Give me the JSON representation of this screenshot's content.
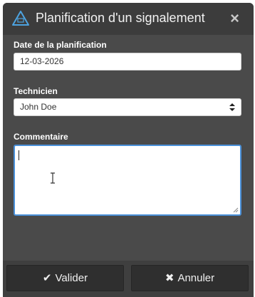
{
  "dialog": {
    "title": "Planification d'un signalement",
    "close_glyph": "×"
  },
  "form": {
    "date": {
      "label": "Date de la planification",
      "value": "12-03-2026"
    },
    "technicien": {
      "label": "Technicien",
      "value": "John Doe"
    },
    "commentaire": {
      "label": "Commentaire",
      "value": ""
    }
  },
  "footer": {
    "valider": {
      "icon": "check-icon",
      "glyph": "✔",
      "label": "Valider"
    },
    "annuler": {
      "icon": "times-icon",
      "glyph": "✖",
      "label": "Annuler"
    }
  },
  "colors": {
    "header_bg": "#3c3c3c",
    "dialog_bg": "#4a4a4a",
    "focus_border": "#4a90d9",
    "button_bg": "#2f2f2f"
  }
}
